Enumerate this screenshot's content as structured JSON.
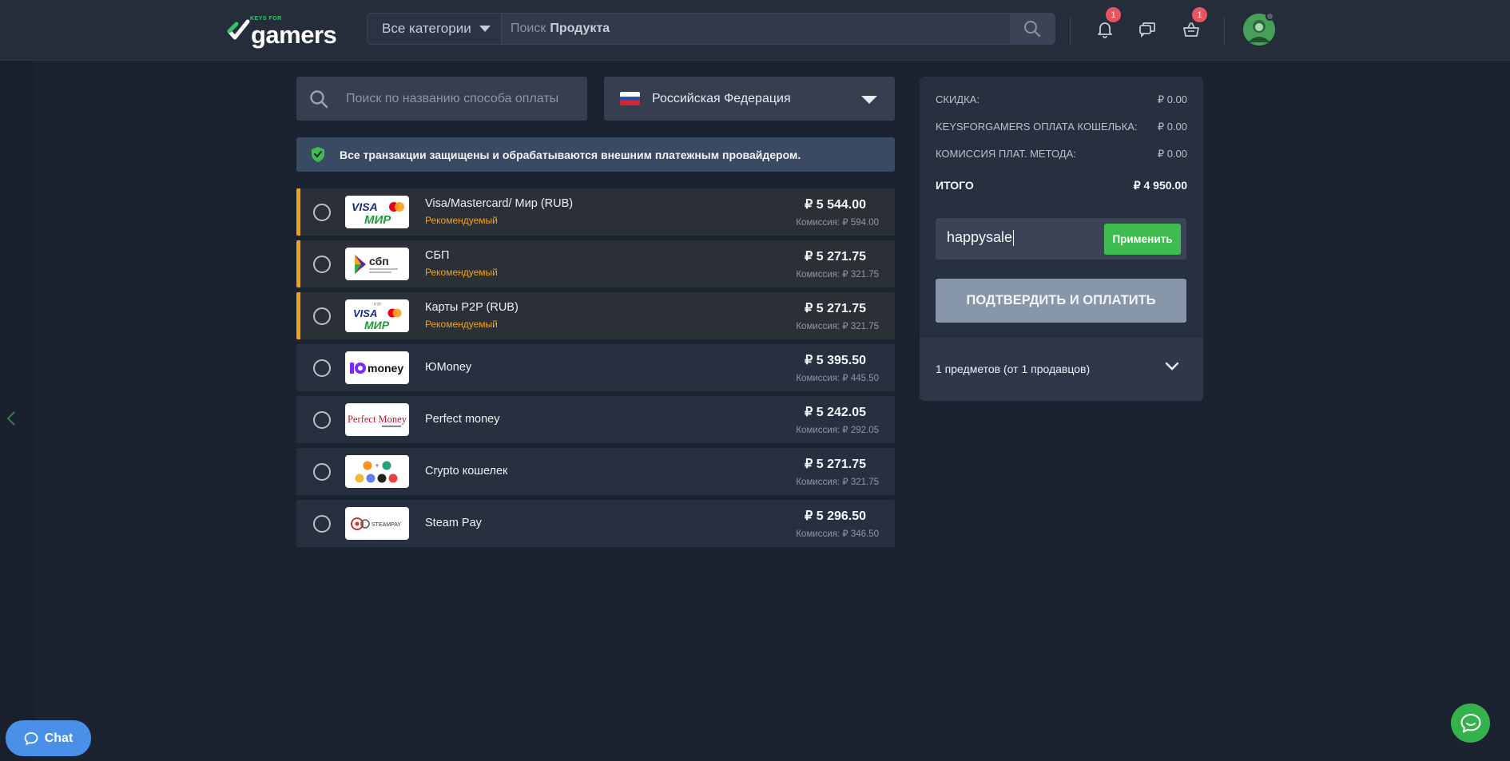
{
  "header": {
    "logo_small": "KEYS FOR",
    "logo_text": "gamers",
    "category_select": "Все категории",
    "search_prefix": "Поиск",
    "search_bold": "Продукта",
    "notifications_badge": "1",
    "cart_badge": "1"
  },
  "filters": {
    "payment_search_placeholder": "Поиск по названию способа оплаты",
    "country": "Российская Федерация"
  },
  "notice": "Все транзакции защищены и обрабатываются внешним платежным провайдером.",
  "payment_methods": [
    {
      "name": "Visa/Mastercard/ Мир (RUB)",
      "tag": "Рекомендуемый",
      "price": "₽ 5 544.00",
      "commission": "Комиссия: ₽ 594.00",
      "logo": "visa-mir-logo",
      "logo_text_a": "VISA",
      "logo_text_b": "МИР"
    },
    {
      "name": "СБП",
      "tag": "Рекомендуемый",
      "price": "₽ 5 271.75",
      "commission": "Комиссия: ₽ 321.75",
      "logo": "sbp-logo",
      "logo_text_a": "сбп"
    },
    {
      "name": "Карты P2P (RUB)",
      "tag": "Рекомендуемый",
      "price": "₽ 5 271.75",
      "commission": "Комиссия: ₽ 321.75",
      "logo": "p2p-logo",
      "logo_text_a": "VISA",
      "logo_text_b": "МИР",
      "logo_text_c": "P2P"
    },
    {
      "name": "ЮMoney",
      "price": "₽ 5 395.50",
      "commission": "Комиссия: ₽ 445.50",
      "logo": "yoomoney-logo",
      "logo_text_a": "money"
    },
    {
      "name": "Perfect money",
      "price": "₽ 5 242.05",
      "commission": "Комиссия: ₽ 292.05",
      "logo": "perfect-money-logo",
      "logo_text_a": "Perfect Money"
    },
    {
      "name": "Crypto кошелек",
      "price": "₽ 5 271.75",
      "commission": "Комиссия: ₽ 321.75",
      "logo": "crypto-logo"
    },
    {
      "name": "Steam Pay",
      "price": "₽ 5 296.50",
      "commission": "Комиссия: ₽ 346.50",
      "logo": "steampay-logo",
      "logo_text_a": "STEAMPAY"
    }
  ],
  "summary": {
    "discount_label": "СКИДКА:",
    "discount_value": "₽ 0.00",
    "wallet_label": "KEYSFORGAMERS ОПЛАТА КОШЕЛЬКА:",
    "wallet_value": "₽ 0.00",
    "fee_label": "КОМИССИЯ ПЛАТ. МЕТОДА:",
    "fee_value": "₽ 0.00",
    "total_label": "ИТОГО",
    "total_value": "₽ 4 950.00",
    "promo_value": "happysale",
    "apply_label": "Применить",
    "confirm_label": "ПОДТВЕРДИТЬ И ОПЛАТИТЬ",
    "items_text": "1 предметов (от 1 продавцов)"
  },
  "chat_label": "Chat",
  "colors": {
    "accent_green": "#3fbc4f",
    "recommended_orange": "#f0a21f",
    "badge_red": "#e65561",
    "chat_blue": "#4a8fe8"
  }
}
